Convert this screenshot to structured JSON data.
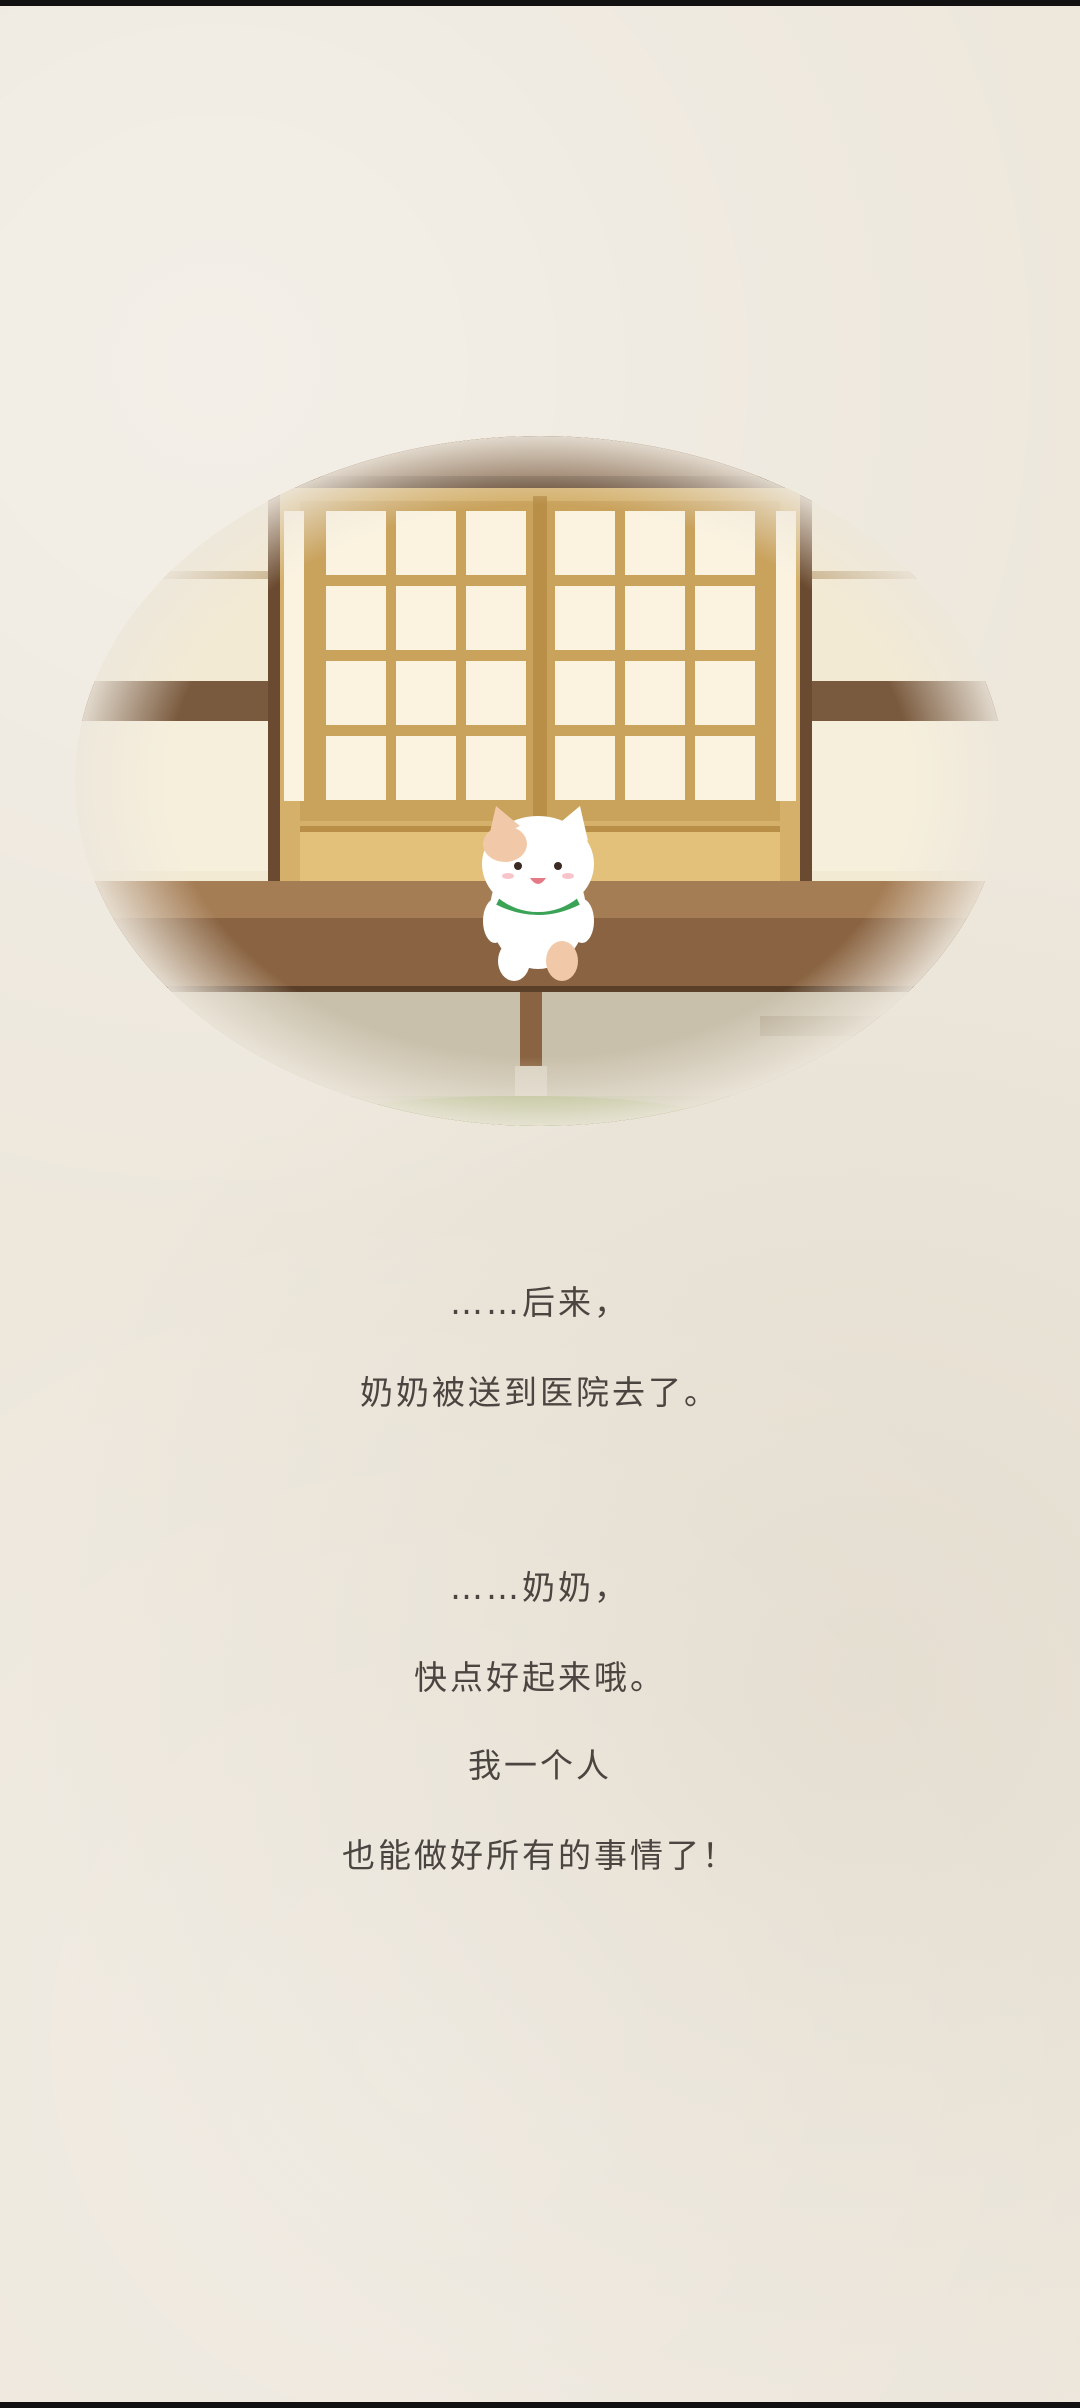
{
  "story": {
    "paragraph1": [
      "……后来，",
      "奶奶被送到医院去了。"
    ],
    "paragraph2": [
      "……奶奶，",
      "快点好起来哦。",
      "我一个人",
      "也能做好所有的事情了！"
    ]
  },
  "colors": {
    "paper": "#ede7dc",
    "text": "#4a4540",
    "wood": "#c9a25c",
    "cat_collar": "#3aa356"
  },
  "icons": {
    "cat": "cat-icon"
  }
}
